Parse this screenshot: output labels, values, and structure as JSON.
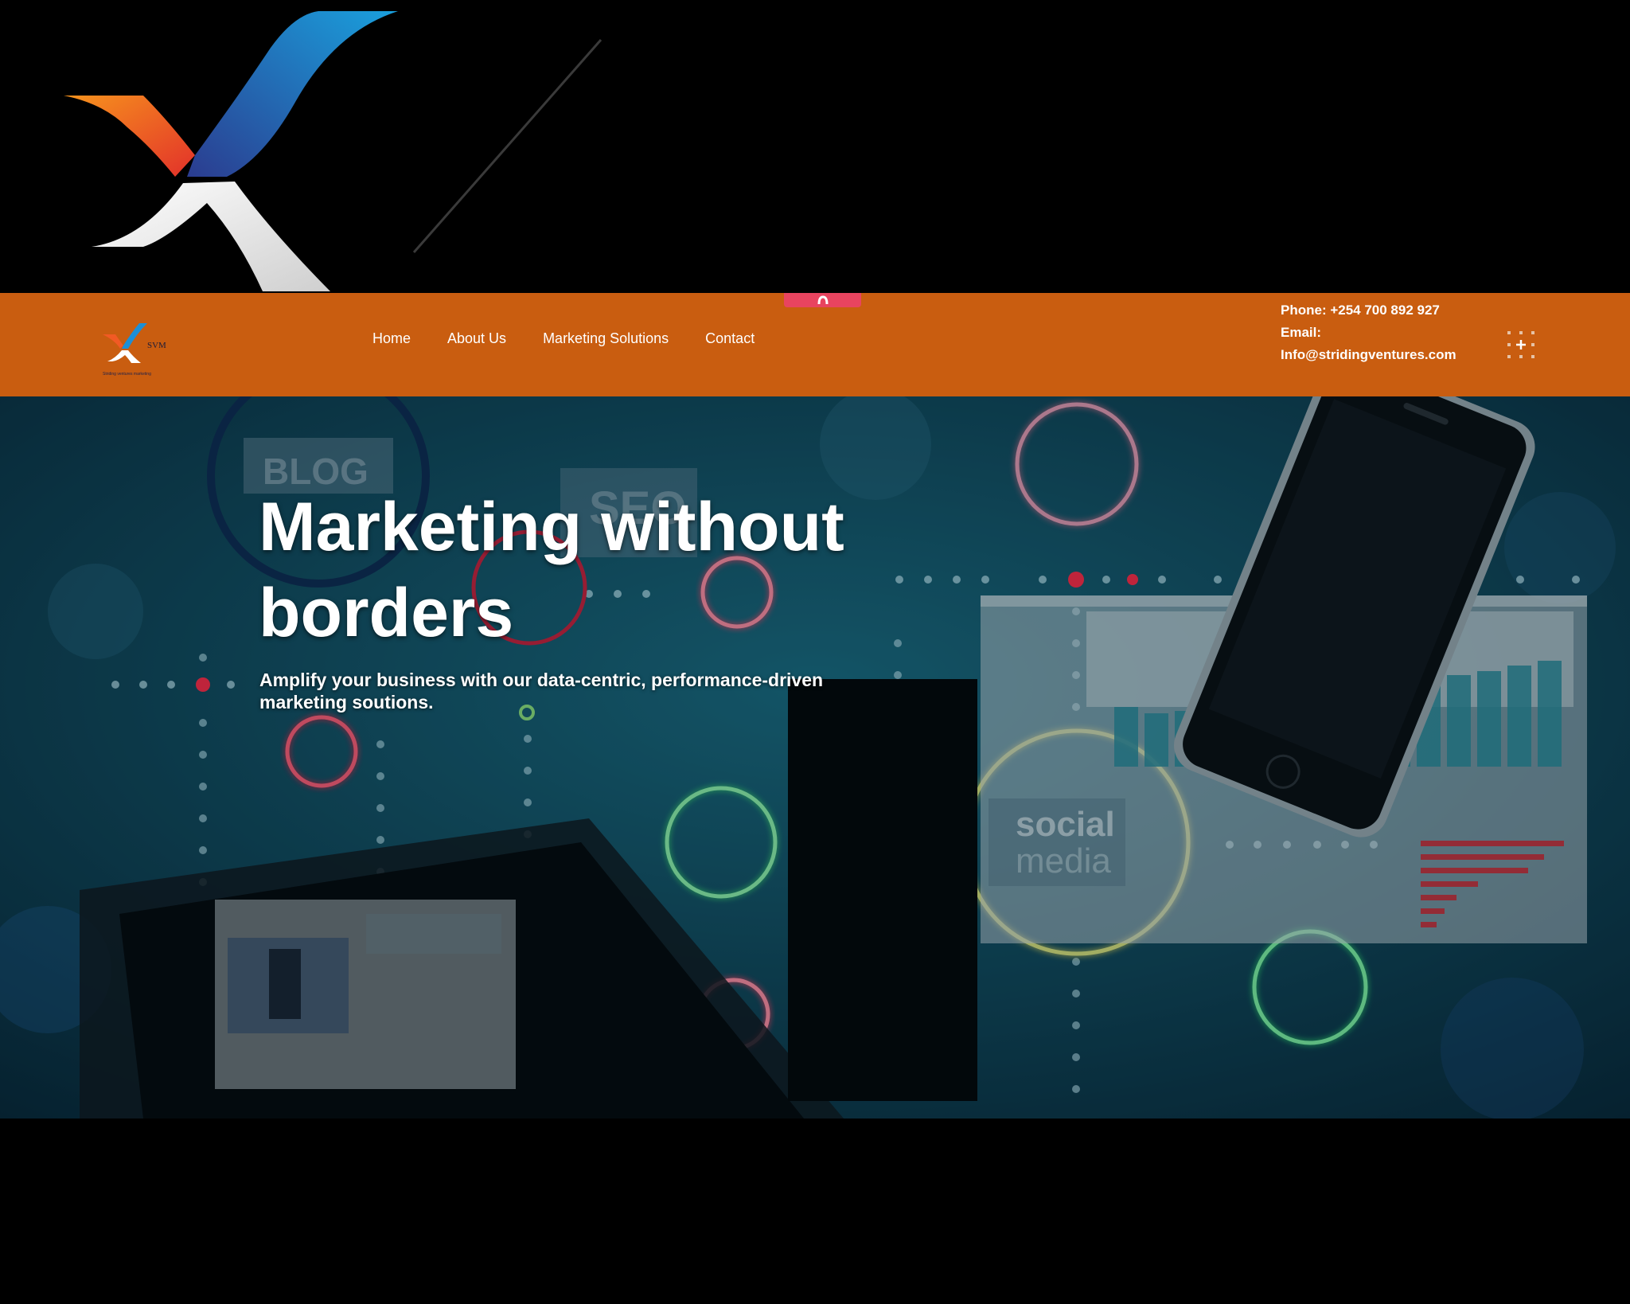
{
  "nav": {
    "links": [
      "Home",
      "About Us",
      "Marketing Solutions",
      "Contact"
    ],
    "logo_text": "SVM",
    "logo_tagline": "Striding ventures marketing"
  },
  "contact": {
    "phone": "Phone: +254 700 892 927",
    "email_label": "Email:",
    "email": "Info@stridingventures.com"
  },
  "hero": {
    "title_line1": "Marketing without",
    "title_line2": "borders",
    "subtitle_line1": "Amplify your business with our data-centric, performance-driven",
    "subtitle_line2": "marketing soutions.",
    "art_labels": [
      "BLOG",
      "SEO",
      "social",
      "media"
    ]
  },
  "colors": {
    "navbar": "#c95d10",
    "scroll_tab": "#e8445f",
    "hero_base": "#0b3a4e"
  },
  "icons": [
    "brand-logo",
    "scroll-up-icon",
    "grid-menu-icon"
  ]
}
